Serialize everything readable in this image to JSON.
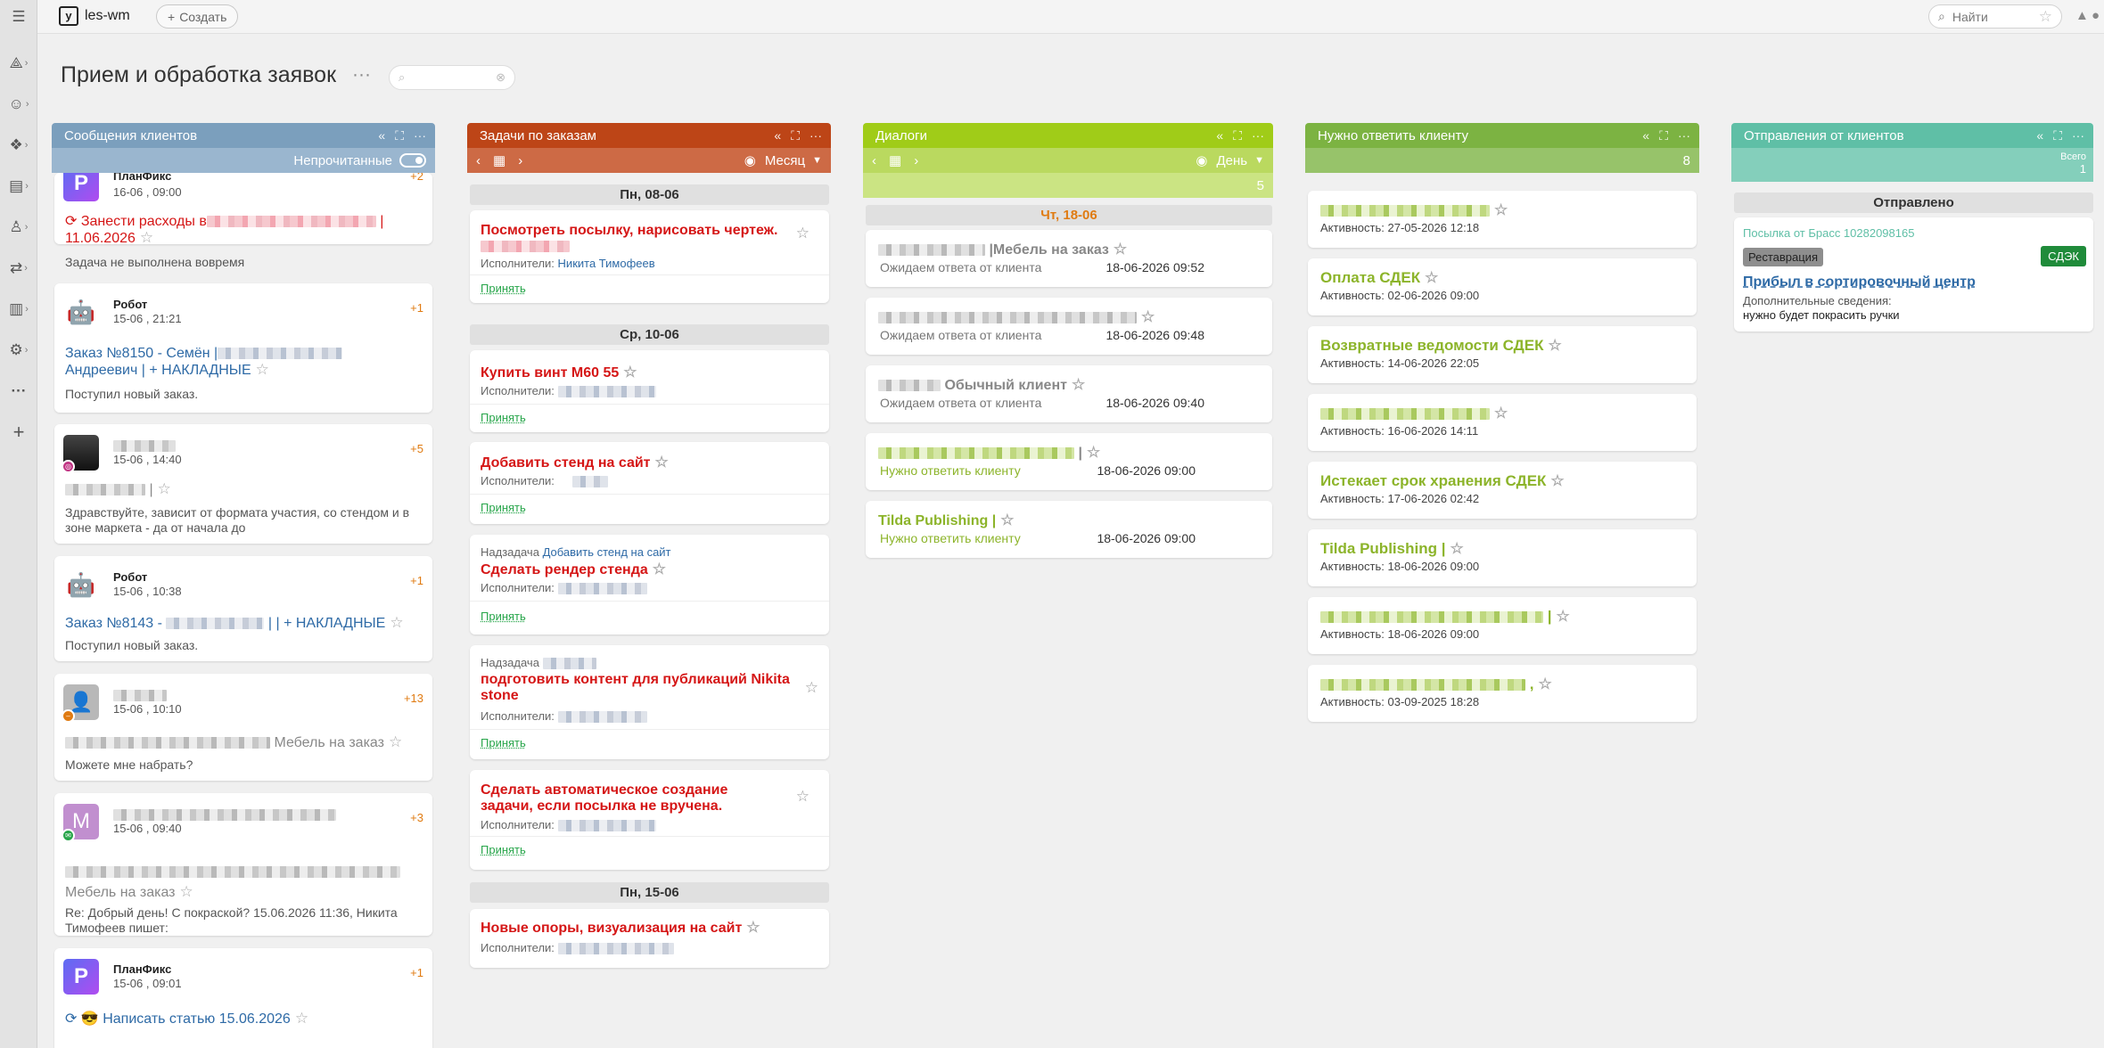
{
  "app": {
    "name": "les-wm",
    "create_label": "Создать",
    "search_label": "Найти"
  },
  "page": {
    "title": "Прием и обработка заявок"
  },
  "columns": {
    "messages": {
      "title": "Сообщения клиентов",
      "filter": "Непрочитанные",
      "cards": [
        {
          "name": "ПланФикс",
          "date": "16-06 , 09:00",
          "count": "+2",
          "title": "Занести расходы в",
          "title_tail": "11.06.2026",
          "subtitle": "Задача не выполнена вовремя"
        },
        {
          "name": "Робот",
          "date": "15-06 , 21:21",
          "count": "+1",
          "title": "Заказ №8150 - Семён |",
          "title2": "Андреевич | + НАКЛАДНЫЕ",
          "subtitle": "Поступил новый заказ."
        },
        {
          "date": "15-06 , 14:40",
          "count": "+5",
          "subtitle": "Здравствуйте, зависит от формата участия, со стендом и в зоне маркета - да от начала до"
        },
        {
          "name": "Робот",
          "date": "15-06 , 10:38",
          "count": "+1",
          "title": "Заказ №8143 -",
          "title_tail": "| | + НАКЛАДНЫЕ",
          "subtitle": "Поступил новый заказ."
        },
        {
          "date": "15-06 , 10:10",
          "count": "+13",
          "title": "Мебель на заказ",
          "subtitle": "Можете мне набрать?"
        },
        {
          "avatar_letter": "M",
          "date": "15-06 , 09:40",
          "count": "+3",
          "title": "Мебель на заказ",
          "subtitle": "Re: Добрый день! С покраской? 15.06.2026 11:36, Никита Тимофеев пишет:"
        },
        {
          "name": "ПланФикс",
          "date": "15-06 , 09:01",
          "count": "+1",
          "title": "Написать статью 15.06.2026"
        }
      ]
    },
    "tasks": {
      "title": "Задачи по заказам",
      "view": "Месяц",
      "days": [
        "Пн, 08-06",
        "Ср, 10-06",
        "Пн, 15-06"
      ],
      "performer_label": "Исполнители:",
      "accept_label": "Принять",
      "subtask_label": "Надзадача",
      "cards": [
        {
          "title": "Посмотреть посылку, нарисовать чертеж.",
          "performer": "Никита Тимофеев"
        },
        {
          "title": "Купить винт М60 55"
        },
        {
          "title": "Добавить стенд на сайт"
        },
        {
          "parent": "Добавить стенд на сайт",
          "title": "Сделать рендер стенда"
        },
        {
          "title": "подготовить контент для публикаций Nikita stone"
        },
        {
          "title": "Сделать автоматическое создание задачи, если посылка не вручена."
        },
        {
          "title": "Новые опоры, визуализация на сайт"
        }
      ]
    },
    "dialogs": {
      "title": "Диалоги",
      "view": "День",
      "count": "5",
      "day": "Чт, 18-06",
      "cards": [
        {
          "title": "Мебель на заказ",
          "status": "Ожидаем ответа от клиента",
          "date": "18-06-2026 09:52"
        },
        {
          "status": "Ожидаем ответа от клиента",
          "date": "18-06-2026 09:48"
        },
        {
          "title": "Обычный клиент",
          "status": "Ожидаем ответа от клиента",
          "date": "18-06-2026 09:40"
        },
        {
          "title": "|",
          "status": "Нужно ответить клиенту",
          "date": "18-06-2026 09:00"
        },
        {
          "title": "Tilda Publishing |",
          "status": "Нужно ответить клиенту",
          "date": "18-06-2026 09:00"
        }
      ]
    },
    "reply": {
      "title": "Нужно ответить клиенту",
      "count": "8",
      "activity_label": "Активность:",
      "cards": [
        {
          "activity": "27-05-2026 12:18"
        },
        {
          "title": "Оплата СДЕК",
          "activity": "02-06-2026 09:00"
        },
        {
          "title": "Возвратные ведомости СДЕК",
          "activity": "14-06-2026 22:05"
        },
        {
          "activity": "16-06-2026 14:11"
        },
        {
          "title": "Истекает срок хранения СДЕК",
          "activity": "17-06-2026 02:42"
        },
        {
          "title": "Tilda Publishing |",
          "activity": "18-06-2026 09:00"
        },
        {
          "title_tail": "|",
          "activity": "18-06-2026 09:00"
        },
        {
          "title_tail": ",",
          "activity": "03-09-2025 18:28"
        }
      ]
    },
    "shipments": {
      "title": "Отправления от клиентов",
      "total_label": "Всего",
      "total": "1",
      "section": "Отправлено",
      "card": {
        "name": "Посылка от Брасс 10282098165",
        "tag": "Реставрация",
        "carrier": "СДЭК",
        "status": "Прибыл в сортировочный центр",
        "extra_label": "Дополнительные сведения:",
        "extra": "нужно будет покрасить ручки"
      }
    }
  }
}
